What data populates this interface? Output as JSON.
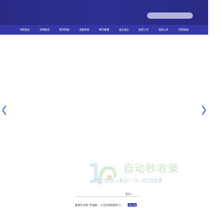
{
  "header": {
    "search": {
      "placeholder": ""
    }
  },
  "nav": {
    "items": [
      {
        "label": "学院首页"
      },
      {
        "label": "学院概况"
      },
      {
        "label": "教学院部"
      },
      {
        "label": "党建思政"
      },
      {
        "label": "教学管理"
      },
      {
        "label": "招生就业"
      },
      {
        "label": "团学工作"
      },
      {
        "label": "信息公开"
      },
      {
        "label": "学院新闻"
      }
    ]
  },
  "slider": {
    "prev_icon": "chevron-left-icon",
    "next_icon": "chevron-right-icon",
    "arrow_color": "#3b6fd8"
  },
  "watermark": {
    "title": "自动秒收录",
    "subtitle": "做上链接→来访一次→自动收录"
  },
  "news": {
    "more_label": "更多>",
    "items": [
      {
        "title": "重振专业再门开营新... 汇总优质前程学习...",
        "date": "05-16"
      }
    ]
  },
  "colors": {
    "header_bg": "#2e2e91",
    "nav_bg": "#3737a9",
    "accent": "#3b3bb0"
  }
}
